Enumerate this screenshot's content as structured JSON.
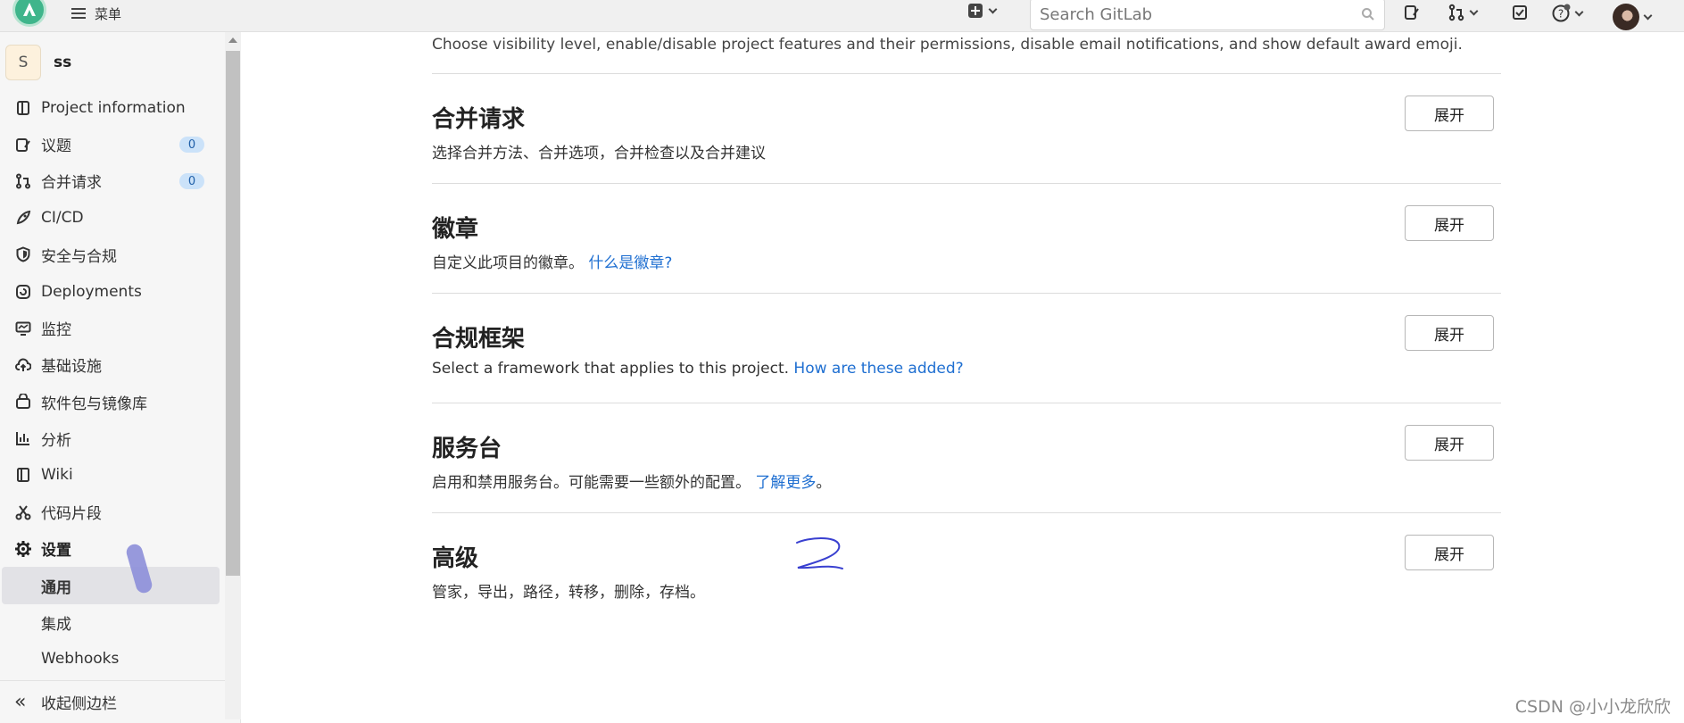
{
  "topbar": {
    "menu_label": "菜单",
    "search_placeholder": "Search GitLab"
  },
  "sidebar": {
    "project_avatar_letter": "S",
    "project_name": "ss",
    "items": [
      {
        "label": "Project information",
        "icon": "project-info-icon"
      },
      {
        "label": "议题",
        "icon": "issues-icon",
        "badge": "0"
      },
      {
        "label": "合并请求",
        "icon": "merge-request-icon",
        "badge": "0"
      },
      {
        "label": "CI/CD",
        "icon": "rocket-icon"
      },
      {
        "label": "安全与合规",
        "icon": "shield-icon"
      },
      {
        "label": "Deployments",
        "icon": "deployments-icon"
      },
      {
        "label": "监控",
        "icon": "monitor-icon"
      },
      {
        "label": "基础设施",
        "icon": "cloud-icon"
      },
      {
        "label": "软件包与镜像库",
        "icon": "package-icon"
      },
      {
        "label": "分析",
        "icon": "chart-icon"
      },
      {
        "label": "Wiki",
        "icon": "book-icon"
      },
      {
        "label": "代码片段",
        "icon": "scissors-icon"
      },
      {
        "label": "设置",
        "icon": "gear-icon"
      },
      {
        "label": "通用",
        "active": true
      },
      {
        "label": "集成"
      },
      {
        "label": "Webhooks"
      }
    ],
    "collapse_label": "收起侧边栏"
  },
  "main": {
    "intro": "Choose visibility level, enable/disable project features and their permissions, disable email notifications, and show default award emoji.",
    "sections": [
      {
        "title": "合并请求",
        "desc": "选择合并方法、合并选项，合并检查以及合并建议",
        "button": "展开"
      },
      {
        "title": "徽章",
        "desc": "自定义此项目的徽章。",
        "link": "什么是徽章?",
        "button": "展开"
      },
      {
        "title": "合规框架",
        "desc": "Select a framework that applies to this project.",
        "link": "How are these added?",
        "button": "展开"
      },
      {
        "title": "服务台",
        "desc": "启用和禁用服务台。可能需要一些额外的配置。",
        "link": "了解更多",
        "suffix": "。",
        "button": "展开"
      },
      {
        "title": "高级",
        "desc": "管家，导出，路径，转移，删除，存档。",
        "button": "展开"
      }
    ]
  },
  "watermark": "CSDN @小小龙欣欣",
  "colors": {
    "link": "#1f6fd1",
    "badge_bg": "#cbe2f9",
    "logo": "#3fb58b"
  }
}
